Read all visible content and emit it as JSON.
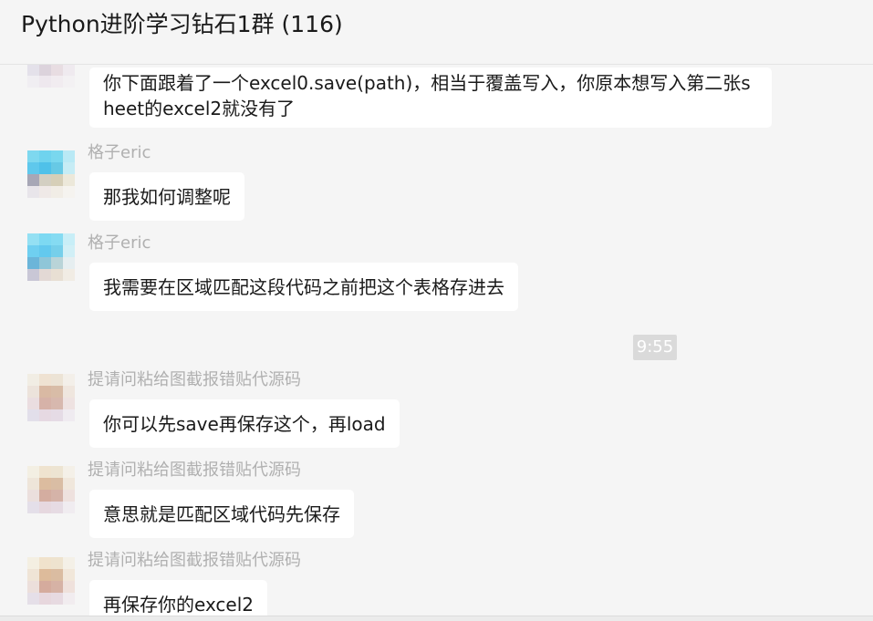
{
  "window": {
    "title": "Python进阶学习钻石1群 (116)"
  },
  "messages": [
    {
      "sender": "",
      "text": "你下面跟着了一个excel0.save(path)，相当于覆盖写入，你原本想写入第二张sheet的excel2就没有了"
    },
    {
      "sender": "格子eric",
      "text": "那我如何调整呢"
    },
    {
      "sender": "格子eric",
      "text": "我需要在区域匹配这段代码之前把这个表格存进去"
    },
    {
      "sender": "提请问粘给图截报错贴代源码",
      "text": "你可以先save再保存这个，再load"
    },
    {
      "sender": "提请问粘给图截报错贴代源码",
      "text": "意思就是匹配区域代码先保存"
    },
    {
      "sender": "提请问粘给图截报错贴代源码",
      "text": "再保存你的excel2"
    }
  ],
  "timestamp": "9:55",
  "colors": {
    "background": "#f5f5f5",
    "bubble": "#ffffff",
    "sender_name": "#b0b0b0",
    "time_badge": "#dadada"
  }
}
